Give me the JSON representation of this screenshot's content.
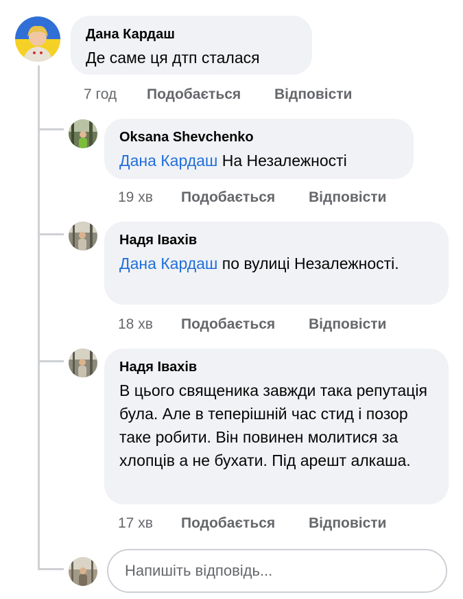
{
  "comment": {
    "author": "Дана Кардаш",
    "text": "Де саме ця дтп сталася",
    "time": "7 год",
    "like_label": "Подобається",
    "reply_label": "Відповісти"
  },
  "replies": [
    {
      "author": "Oksana Shevchenko",
      "mention": "Дана Кардаш",
      "text": " На Незалежності",
      "time": "19 хв",
      "like_label": "Подобається",
      "reply_label": "Відповісти"
    },
    {
      "author": "Надя Івахів",
      "mention": "Дана Кардаш",
      "text": " по вулиці Незалежності.",
      "time": "18 хв",
      "like_label": "Подобається",
      "reply_label": "Відповісти"
    },
    {
      "author": "Надя Івахів",
      "mention": "",
      "text": "В цього священика завжди така репутація була. Але в теперішній час стид і позор таке робити. Він повинен молитися за хлопців а не бухати. Під арешт алкаша.",
      "time": "17 хв",
      "like_label": "Подобається",
      "reply_label": "Відповісти"
    }
  ],
  "reply_input": {
    "placeholder": "Напишіть відповідь...",
    "value": ""
  },
  "colors": {
    "bubble": "#f0f2f5",
    "meta": "#65676b",
    "mention": "#216fdb",
    "thread_line": "#ced0d4"
  }
}
